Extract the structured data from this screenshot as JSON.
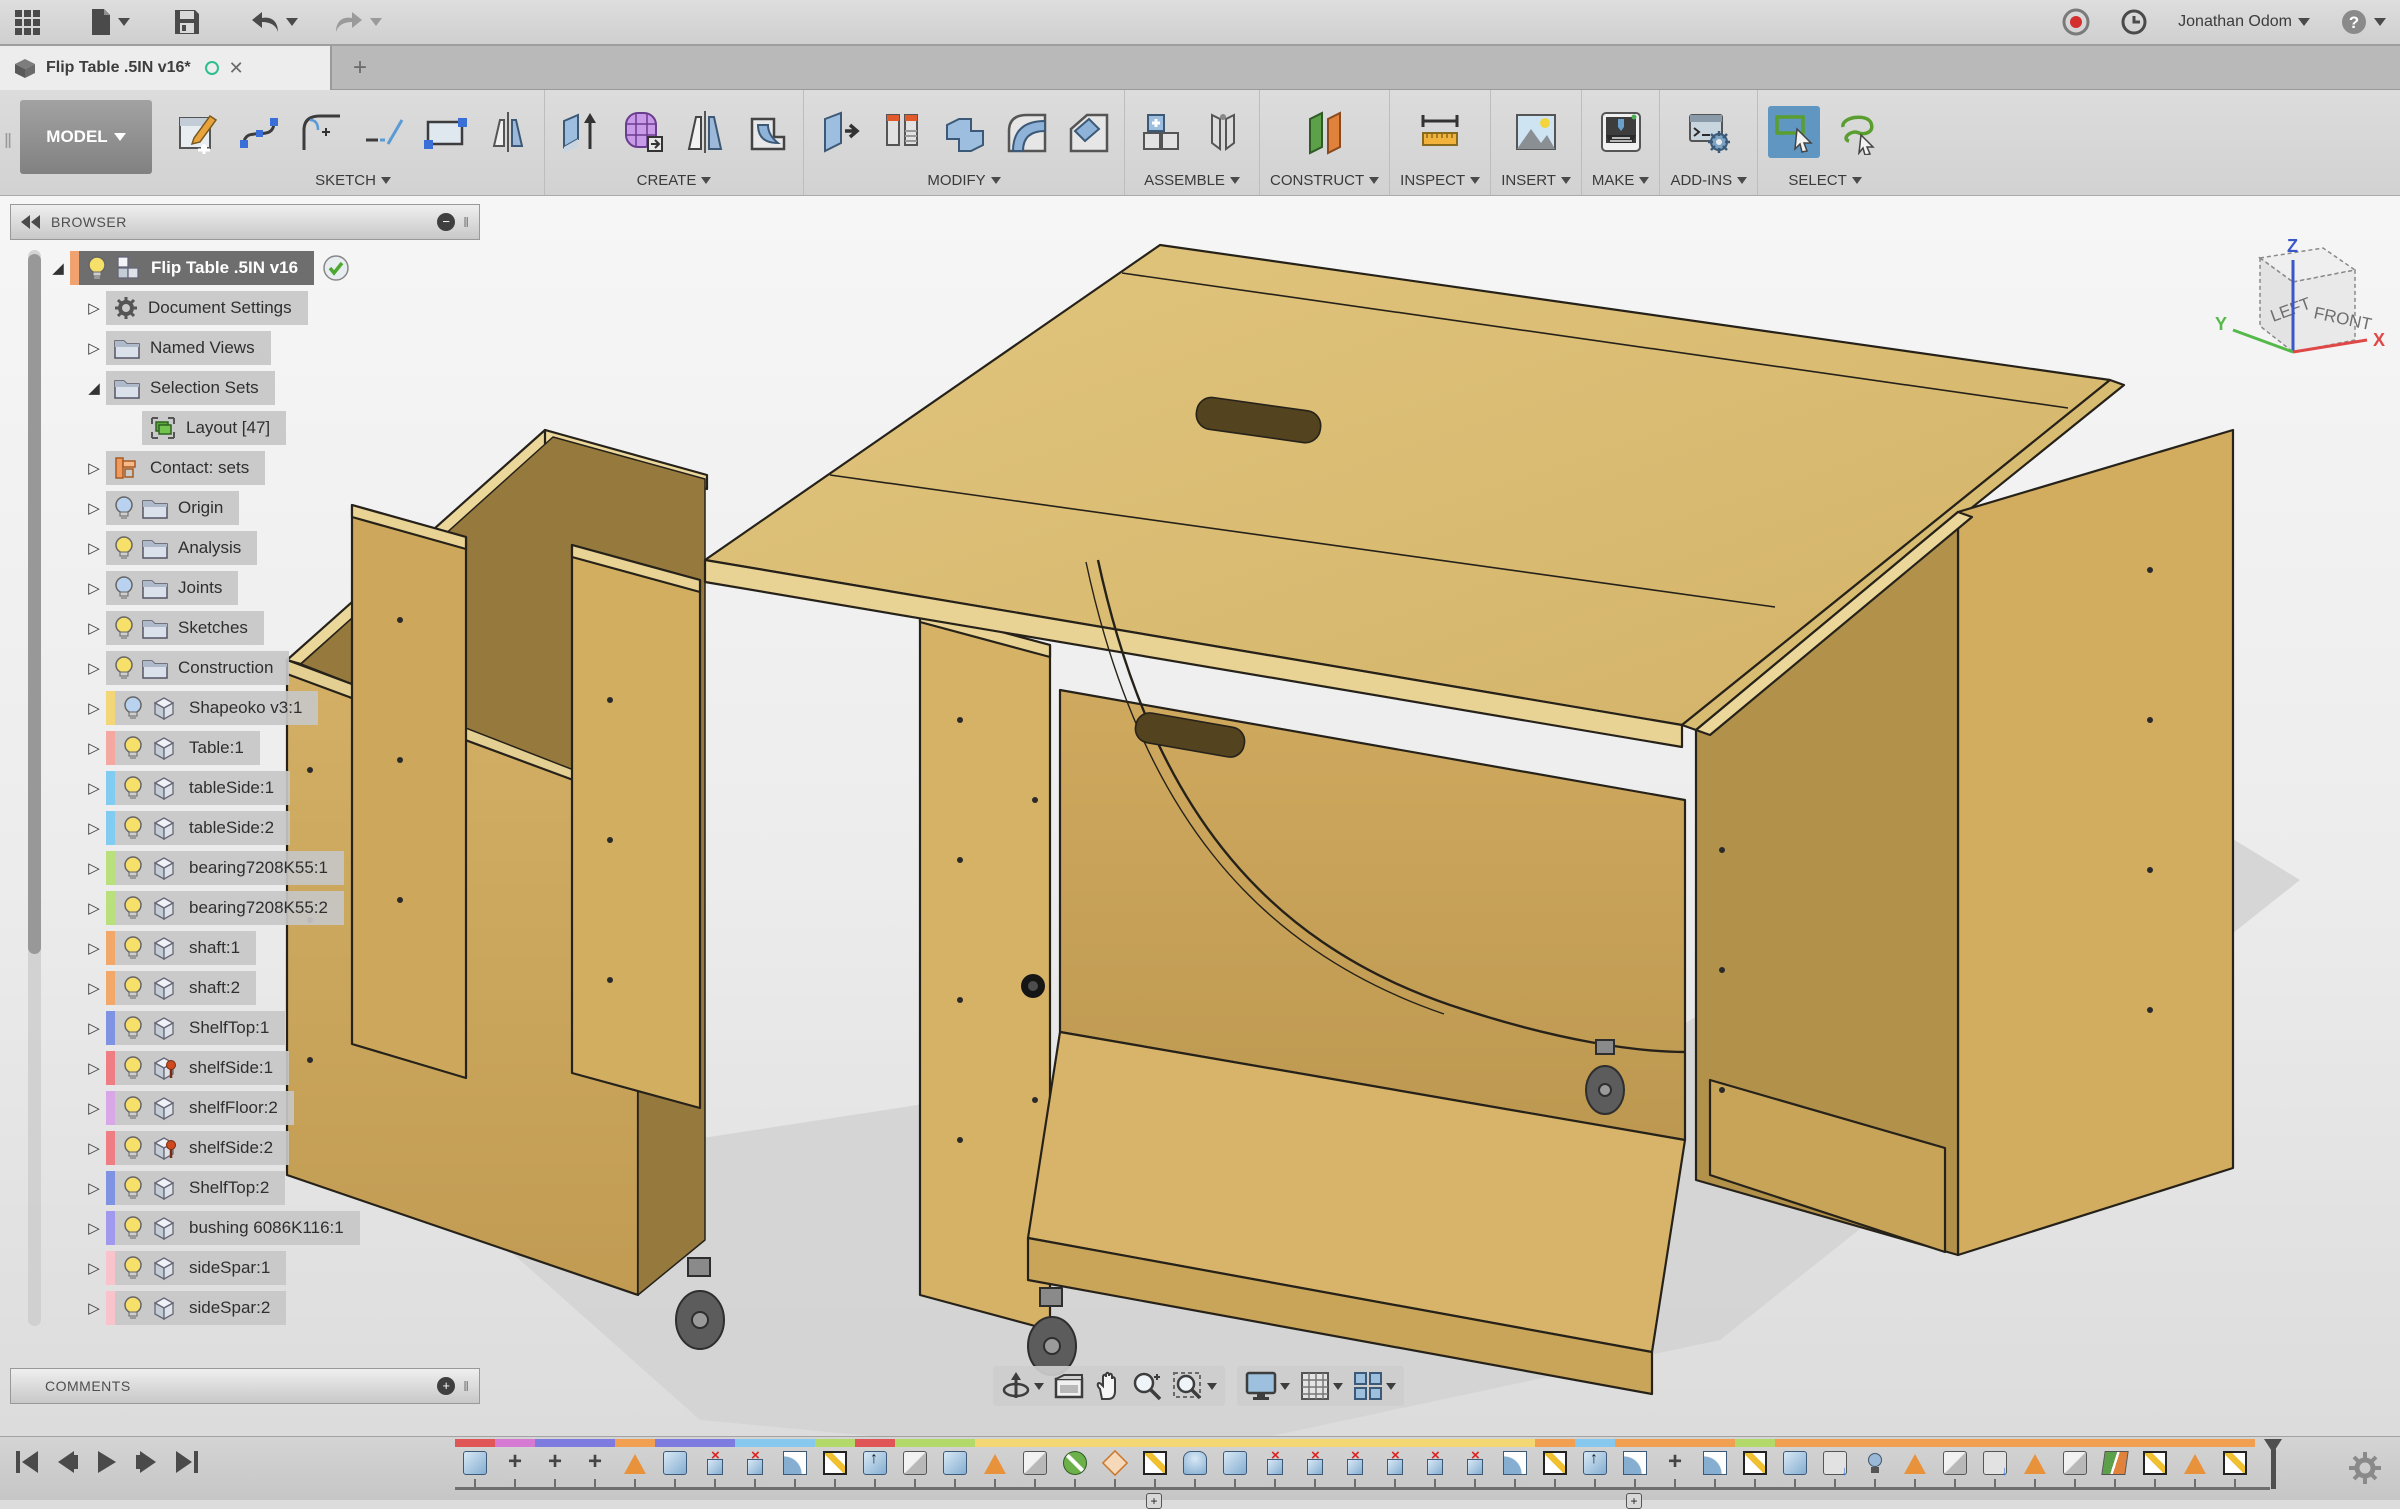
{
  "topbar": {
    "user": "Jonathan Odom"
  },
  "tab": {
    "title": "Flip Table .5IN v16*"
  },
  "toolbar": {
    "mode": "MODEL",
    "groups": [
      {
        "label": "SKETCH",
        "tools": [
          "create-sketch",
          "spline",
          "arc",
          "line",
          "rectangle",
          "mirror-sketch"
        ]
      },
      {
        "label": "CREATE",
        "tools": [
          "extrude",
          "form",
          "mirror",
          "shell"
        ]
      },
      {
        "label": "MODIFY",
        "tools": [
          "press-pull",
          "appearance",
          "combine",
          "fillet",
          "chamfer"
        ]
      },
      {
        "label": "ASSEMBLE",
        "tools": [
          "new-component",
          "joint"
        ]
      },
      {
        "label": "CONSTRUCT",
        "tools": [
          "construction-plane"
        ]
      },
      {
        "label": "INSPECT",
        "tools": [
          "measure"
        ]
      },
      {
        "label": "INSERT",
        "tools": [
          "insert-image"
        ]
      },
      {
        "label": "MAKE",
        "tools": [
          "3d-print"
        ]
      },
      {
        "label": "ADD-INS",
        "tools": [
          "scripts-addins"
        ]
      },
      {
        "label": "SELECT",
        "tools": [
          "window-select",
          "lasso-select"
        ]
      }
    ]
  },
  "browser": {
    "title": "BROWSER",
    "items": [
      {
        "label": "Flip Table .5IN v16",
        "level": 0,
        "strip": "#f0a36e",
        "bulb": "on",
        "icon": "component-root",
        "arrow": "expanded",
        "selected": true,
        "check": true
      },
      {
        "label": "Document Settings",
        "level": 1,
        "strip": null,
        "bulb": null,
        "icon": "gear",
        "arrow": "collapsed"
      },
      {
        "label": "Named Views",
        "level": 1,
        "strip": null,
        "bulb": null,
        "icon": "folder",
        "arrow": "collapsed"
      },
      {
        "label": "Selection Sets",
        "level": 1,
        "strip": null,
        "bulb": null,
        "icon": "folder",
        "arrow": "expanded"
      },
      {
        "label": "Layout [47]",
        "level": 2,
        "strip": null,
        "bulb": null,
        "icon": "layers",
        "arrow": "none"
      },
      {
        "label": "Contact: sets",
        "level": 1,
        "strip": null,
        "bulb": null,
        "icon": "contact",
        "arrow": "collapsed"
      },
      {
        "label": "Origin",
        "level": 1,
        "strip": null,
        "bulb": "off",
        "icon": "folder",
        "arrow": "collapsed"
      },
      {
        "label": "Analysis",
        "level": 1,
        "strip": null,
        "bulb": "on",
        "icon": "folder",
        "arrow": "collapsed"
      },
      {
        "label": "Joints",
        "level": 1,
        "strip": null,
        "bulb": "off",
        "icon": "folder",
        "arrow": "collapsed"
      },
      {
        "label": "Sketches",
        "level": 1,
        "strip": null,
        "bulb": "on",
        "icon": "folder",
        "arrow": "collapsed"
      },
      {
        "label": "Construction",
        "level": 1,
        "strip": null,
        "bulb": "on",
        "icon": "folder",
        "arrow": "collapsed"
      },
      {
        "label": "Shapeoko v3:1",
        "level": 1,
        "strip": "#f3d678",
        "bulb": "off",
        "icon": "cube",
        "arrow": "collapsed"
      },
      {
        "label": "Table:1",
        "level": 1,
        "strip": "#f5a8a0",
        "bulb": "on",
        "icon": "cube",
        "arrow": "collapsed"
      },
      {
        "label": "tableSide:1",
        "level": 1,
        "strip": "#82ccf2",
        "bulb": "on",
        "icon": "cube",
        "arrow": "collapsed"
      },
      {
        "label": "tableSide:2",
        "level": 1,
        "strip": "#82ccf2",
        "bulb": "on",
        "icon": "cube",
        "arrow": "collapsed"
      },
      {
        "label": "bearing7208K55:1",
        "level": 1,
        "strip": "#b9e07d",
        "bulb": "on",
        "icon": "cube",
        "arrow": "collapsed"
      },
      {
        "label": "bearing7208K55:2",
        "level": 1,
        "strip": "#b9e07d",
        "bulb": "on",
        "icon": "cube",
        "arrow": "collapsed"
      },
      {
        "label": "shaft:1",
        "level": 1,
        "strip": "#f2a869",
        "bulb": "on",
        "icon": "cube",
        "arrow": "collapsed"
      },
      {
        "label": "shaft:2",
        "level": 1,
        "strip": "#f2a869",
        "bulb": "on",
        "icon": "cube",
        "arrow": "collapsed"
      },
      {
        "label": "ShelfTop:1",
        "level": 1,
        "strip": "#7e93e2",
        "bulb": "on",
        "icon": "cube",
        "arrow": "collapsed"
      },
      {
        "label": "shelfSide:1",
        "level": 1,
        "strip": "#ee7e84",
        "bulb": "on",
        "icon": "cube-pinned",
        "arrow": "collapsed"
      },
      {
        "label": "shelfFloor:2",
        "level": 1,
        "strip": "#d9a7e8",
        "bulb": "on",
        "icon": "cube",
        "arrow": "collapsed"
      },
      {
        "label": "shelfSide:2",
        "level": 1,
        "strip": "#ee7e84",
        "bulb": "on",
        "icon": "cube-pinned",
        "arrow": "collapsed"
      },
      {
        "label": "ShelfTop:2",
        "level": 1,
        "strip": "#7e93e2",
        "bulb": "on",
        "icon": "cube",
        "arrow": "collapsed"
      },
      {
        "label": "bushing 6086K116:1",
        "level": 1,
        "strip": "#a099ee",
        "bulb": "on",
        "icon": "cube",
        "arrow": "collapsed"
      },
      {
        "label": "sideSpar:1",
        "level": 1,
        "strip": "#f9c3cc",
        "bulb": "on",
        "icon": "cube",
        "arrow": "collapsed"
      },
      {
        "label": "sideSpar:2",
        "level": 1,
        "strip": "#f9c3cc",
        "bulb": "on",
        "icon": "cube",
        "arrow": "collapsed"
      }
    ]
  },
  "comments": {
    "title": "COMMENTS"
  },
  "viewcube": {
    "face_left": "LEFT",
    "face_front": "FRONT",
    "axis_x": "X",
    "axis_y": "Y",
    "axis_z": "Z"
  },
  "timeline": {
    "features": [
      {
        "icon": "box",
        "color": "#e05656"
      },
      {
        "icon": "move",
        "color": "#d579d2"
      },
      {
        "icon": "move",
        "color": "#7d7ae0"
      },
      {
        "icon": "move",
        "color": "#7d7ae0"
      },
      {
        "icon": "chev",
        "color": "#f0a050"
      },
      {
        "icon": "box",
        "color": "#7d7ae0"
      },
      {
        "icon": "del",
        "color": "#7d7ae0"
      },
      {
        "icon": "del",
        "color": "#86c8ee"
      },
      {
        "icon": "curve",
        "color": "#86c8ee"
      },
      {
        "icon": "sketch",
        "color": "#b3d96a"
      },
      {
        "icon": "ext",
        "color": "#e05656"
      },
      {
        "icon": "joint",
        "color": "#b3d96a"
      },
      {
        "icon": "box",
        "color": "#b3d96a"
      },
      {
        "icon": "chev",
        "color": "#f2d774"
      },
      {
        "icon": "joint",
        "color": "#f2d774"
      },
      {
        "icon": "slash",
        "color": "#f2d774"
      },
      {
        "icon": "diam",
        "color": "#f2d774"
      },
      {
        "icon": "sketch",
        "color": "#f2d774"
      },
      {
        "icon": "rev",
        "color": "#f2d774"
      },
      {
        "icon": "box",
        "color": "#f2d774"
      },
      {
        "icon": "del",
        "color": "#f2d774"
      },
      {
        "icon": "del",
        "color": "#f2d774"
      },
      {
        "icon": "del",
        "color": "#f2d774"
      },
      {
        "icon": "del",
        "color": "#f2d774"
      },
      {
        "icon": "del",
        "color": "#f2d774"
      },
      {
        "icon": "del",
        "color": "#f2d774"
      },
      {
        "icon": "curve",
        "color": "#f2d774"
      },
      {
        "icon": "sketch",
        "color": "#f0a050"
      },
      {
        "icon": "ext",
        "color": "#86c8ee"
      },
      {
        "icon": "curve",
        "color": "#f0a050"
      },
      {
        "icon": "move",
        "color": "#f0a050"
      },
      {
        "icon": "curve",
        "color": "#f0a050"
      },
      {
        "icon": "sketch",
        "color": "#b3d96a"
      },
      {
        "icon": "box",
        "color": "#f0a050"
      },
      {
        "icon": "comp",
        "color": "#f0a050"
      },
      {
        "icon": "pin",
        "color": "#f0a050"
      },
      {
        "icon": "chev",
        "color": "#f0a050"
      },
      {
        "icon": "joint",
        "color": "#f0a050"
      },
      {
        "icon": "comp",
        "color": "#f0a050"
      },
      {
        "icon": "chev",
        "color": "#f0a050"
      },
      {
        "icon": "joint",
        "color": "#f0a050"
      },
      {
        "icon": "plane",
        "color": "#f0a050"
      },
      {
        "icon": "sketch",
        "color": "#f0a050"
      },
      {
        "icon": "chev",
        "color": "#f0a050"
      },
      {
        "icon": "sketch",
        "color": "#f0a050"
      }
    ]
  },
  "colors": {
    "select_active": "#5f97c2",
    "wood_top": "#dcbf75",
    "wood_side": "#c9a55a"
  }
}
